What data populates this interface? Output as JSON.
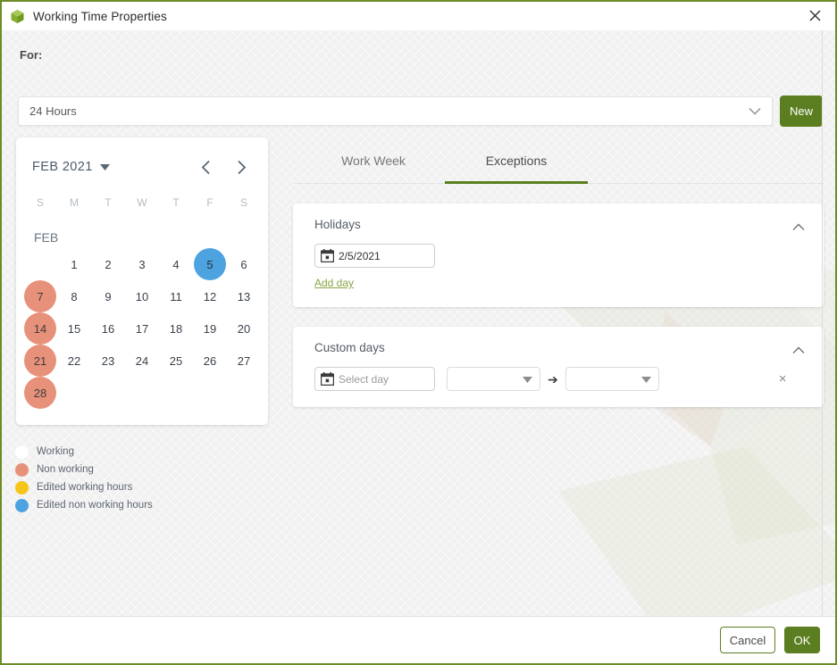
{
  "window": {
    "title": "Working Time Properties",
    "app_icon": "cube-icon",
    "close_icon": "close-icon",
    "accent_color": "#5b7f20",
    "border_color": "#6d8c28"
  },
  "toolbar": {
    "for_label": "For:",
    "calendar_select": {
      "value": "24 Hours",
      "caret_icon": "chevron-down-icon"
    },
    "new_label": "New"
  },
  "calendar": {
    "month_year": "FEB 2021",
    "month_caret_icon": "caret-down-icon",
    "prev_icon": "chevron-left-icon",
    "next_icon": "chevron-right-icon",
    "weekdays": [
      "S",
      "M",
      "T",
      "W",
      "T",
      "F",
      "S"
    ],
    "month_label": "FEB",
    "lead_blanks": 1,
    "days": [
      {
        "n": "1",
        "state": "working"
      },
      {
        "n": "2",
        "state": "working"
      },
      {
        "n": "3",
        "state": "working"
      },
      {
        "n": "4",
        "state": "working"
      },
      {
        "n": "5",
        "state": "editednonworking"
      },
      {
        "n": "6",
        "state": "working"
      },
      {
        "n": "7",
        "state": "nonworking"
      },
      {
        "n": "8",
        "state": "working"
      },
      {
        "n": "9",
        "state": "working"
      },
      {
        "n": "10",
        "state": "working"
      },
      {
        "n": "11",
        "state": "working"
      },
      {
        "n": "12",
        "state": "working"
      },
      {
        "n": "13",
        "state": "working"
      },
      {
        "n": "14",
        "state": "nonworking"
      },
      {
        "n": "15",
        "state": "working"
      },
      {
        "n": "16",
        "state": "working"
      },
      {
        "n": "17",
        "state": "working"
      },
      {
        "n": "18",
        "state": "working"
      },
      {
        "n": "19",
        "state": "working"
      },
      {
        "n": "20",
        "state": "working"
      },
      {
        "n": "21",
        "state": "nonworking"
      },
      {
        "n": "22",
        "state": "working"
      },
      {
        "n": "23",
        "state": "working"
      },
      {
        "n": "24",
        "state": "working"
      },
      {
        "n": "25",
        "state": "working"
      },
      {
        "n": "26",
        "state": "working"
      },
      {
        "n": "27",
        "state": "working"
      },
      {
        "n": "28",
        "state": "nonworking"
      }
    ]
  },
  "legend": {
    "items": [
      {
        "label": "Working",
        "color": "#ffffff"
      },
      {
        "label": "Non working",
        "color": "#e8917a"
      },
      {
        "label": "Edited working hours",
        "color": "#f5c518"
      },
      {
        "label": "Edited non working hours",
        "color": "#4da2e0"
      }
    ]
  },
  "tabs": [
    {
      "label": "Work Week",
      "active": false
    },
    {
      "label": "Exceptions",
      "active": true
    }
  ],
  "holidays": {
    "title": "Holidays",
    "collapse_icon": "chevron-up-icon",
    "date_icon": "calendar-icon",
    "date_value": "2/5/2021",
    "add_day_label": "Add day"
  },
  "custom_days": {
    "title": "Custom days",
    "collapse_icon": "chevron-up-icon",
    "date_icon": "calendar-icon",
    "date_placeholder": "Select day",
    "from_value": "",
    "to_value": "",
    "arrow_glyph": "➔",
    "remove_glyph": "×",
    "dropdown_icon": "caret-down-icon"
  },
  "footer": {
    "cancel_label": "Cancel",
    "ok_label": "OK"
  }
}
